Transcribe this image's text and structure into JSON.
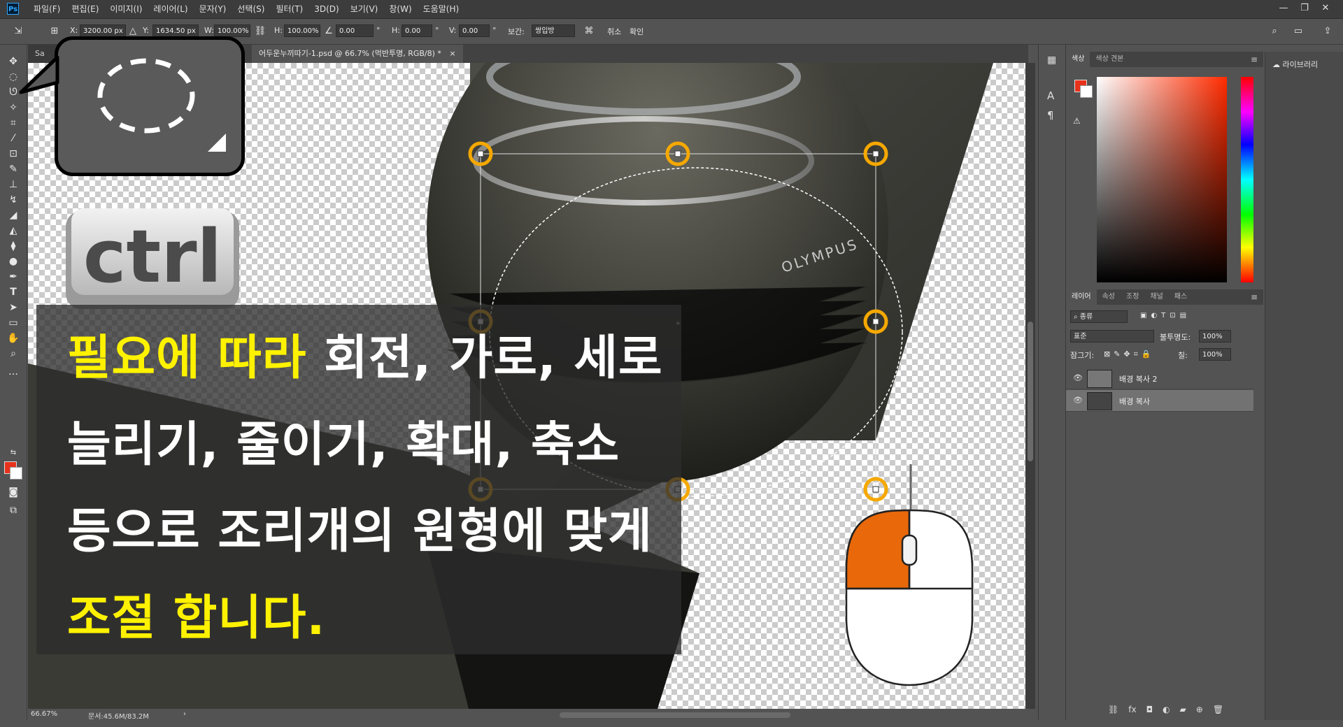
{
  "app": {
    "logo": "Ps",
    "menu": [
      "파일(F)",
      "편집(E)",
      "이미지(I)",
      "레이어(L)",
      "문자(Y)",
      "선택(S)",
      "필터(T)",
      "3D(D)",
      "보기(V)",
      "창(W)",
      "도움말(H)"
    ],
    "window_controls": [
      "—",
      "❐",
      "✕"
    ]
  },
  "options": {
    "x_label": "X:",
    "x_value": "3200.00 px",
    "y_label": "Y:",
    "y_value": "1634.50 px",
    "w_label": "W:",
    "w_value": "100.00%",
    "h_label": "H:",
    "h_value": "100.00%",
    "angle_value": "0.00",
    "hskew_label": "H:",
    "hskew_value": "0.00",
    "vskew_label": "V:",
    "vskew_value": "0.00",
    "degree": "°",
    "interp_label": "보간:",
    "interp_value": "쌍입방",
    "cancel_label": "취소",
    "commit_label": "확인"
  },
  "document": {
    "tab_first": "Sa",
    "tab_active": "어두운누끼따기-1.psd @ 66.7% (먹반투명, RGB/8) *",
    "tab_close": "×",
    "zoom": "66.67%",
    "doc_info": "문서:45.6M/83.2M"
  },
  "overlay": {
    "ctrl_key": "ctrl",
    "caption": [
      [
        {
          "text": "필요에 따라",
          "hl": true
        },
        {
          "text": " 회전, 가로, 세로",
          "hl": false
        }
      ],
      [
        {
          "text": "늘리기, 줄이기, 확대, 축소",
          "hl": false
        }
      ],
      [
        {
          "text": "등으로 조리개의 원형에 맞게",
          "hl": false
        }
      ],
      [
        {
          "text": "조절 합니다.",
          "hl": true
        }
      ]
    ],
    "highlight_color": "#fff200",
    "mouse_accent_color": "#e8680a",
    "handle_color": "#f5a800"
  },
  "color_panel": {
    "tabs": [
      "색상",
      "색상 견본"
    ],
    "foreground": "#e8311b",
    "background": "#ffffff"
  },
  "layers_panel": {
    "tabs": [
      "레이어",
      "속성",
      "조정",
      "채널",
      "패스"
    ],
    "filter_label": "종류",
    "blend_mode": "표준",
    "opacity_label": "불투명도:",
    "opacity_value": "100%",
    "lock_label": "잠그기:",
    "fill_label": "칠:",
    "fill_value": "100%",
    "layers": [
      {
        "name": "배경 복사 2",
        "selected": false
      },
      {
        "name": "배경 복사",
        "selected": true
      }
    ]
  },
  "library_panel": {
    "title": "라이브러리"
  }
}
